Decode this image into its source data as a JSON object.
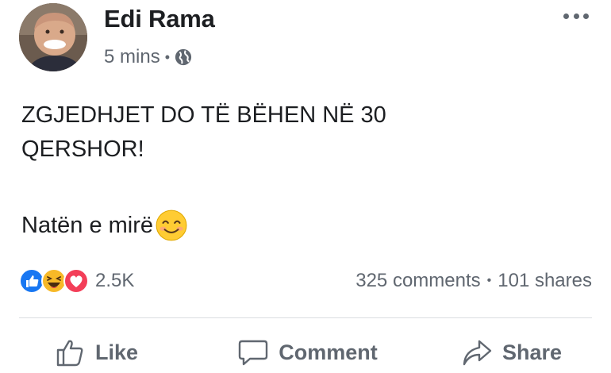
{
  "post": {
    "author": "Edi Rama",
    "time": "5 mins",
    "meta_separator": "•",
    "privacy_icon": "globe-icon",
    "text_line1": "ZGJEDHJET DO TË BËHEN NË 30",
    "text_line2": "QERSHOR!",
    "text_line3": "Natën e mirë",
    "text_emoji": "smiling-face-icon"
  },
  "stats": {
    "reaction_icons": [
      "like-icon",
      "haha-icon",
      "love-icon"
    ],
    "reactions_count": "2.5K",
    "comments": "325 comments",
    "separator": "•",
    "shares": "101 shares"
  },
  "actions": {
    "like_label": "Like",
    "comment_label": "Comment",
    "share_label": "Share"
  },
  "colors": {
    "text": "#1c1e21",
    "secondary": "#606770",
    "like_blue": "#1877f2",
    "love_red": "#f33e58",
    "haha_yellow": "#f7b928"
  }
}
